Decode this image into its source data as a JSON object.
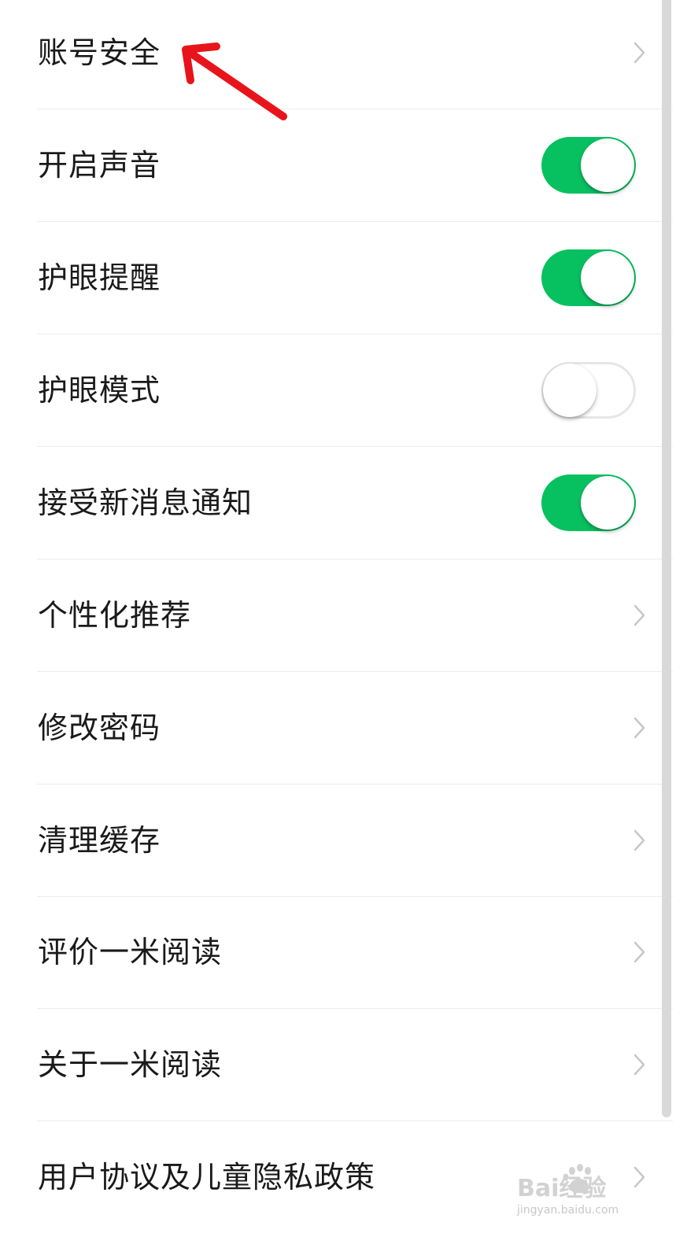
{
  "settings": {
    "items": [
      {
        "label": "账号安全",
        "control": "chevron"
      },
      {
        "label": "开启声音",
        "control": "toggle",
        "on": true
      },
      {
        "label": "护眼提醒",
        "control": "toggle",
        "on": true
      },
      {
        "label": "护眼模式",
        "control": "toggle",
        "on": false
      },
      {
        "label": "接受新消息通知",
        "control": "toggle",
        "on": true
      },
      {
        "label": "个性化推荐",
        "control": "chevron"
      },
      {
        "label": "修改密码",
        "control": "chevron"
      },
      {
        "label": "清理缓存",
        "control": "chevron"
      },
      {
        "label": "评价一米阅读",
        "control": "chevron"
      },
      {
        "label": "关于一米阅读",
        "control": "chevron"
      },
      {
        "label": "用户协议及儿童隐私政策",
        "control": "chevron"
      }
    ]
  },
  "colors": {
    "toggle_on": "#07c160",
    "annotation_arrow": "#e8141c",
    "chevron": "#c7c7cc"
  },
  "watermark": {
    "logo_text": "Bai经验",
    "url": "jingyan.baidu.com"
  }
}
